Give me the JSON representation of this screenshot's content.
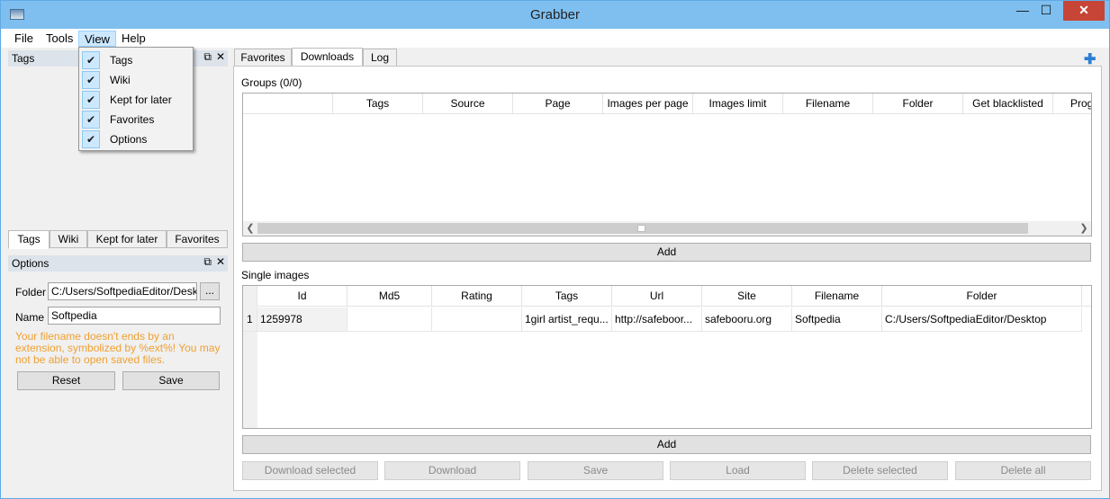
{
  "window": {
    "title": "Grabber"
  },
  "menubar": {
    "file": "File",
    "tools": "Tools",
    "view": "View",
    "help": "Help"
  },
  "view_menu": {
    "items": [
      {
        "label": "Tags",
        "checked": true
      },
      {
        "label": "Wiki",
        "checked": true
      },
      {
        "label": "Kept for later",
        "checked": true
      },
      {
        "label": "Favorites",
        "checked": true
      },
      {
        "label": "Options",
        "checked": true
      }
    ]
  },
  "tags_dock": {
    "title": "Tags"
  },
  "left_tabs": [
    "Tags",
    "Wiki",
    "Kept for later",
    "Favorites"
  ],
  "options_dock": {
    "title": "Options",
    "folder_label": "Folder",
    "folder_value": "C:/Users/SoftpediaEditor/Desktop",
    "browse_label": "...",
    "name_label": "Name",
    "name_value": "Softpedia",
    "warning": "Your filename doesn't ends by an extension, symbolized by %ext%! You may not be able to open saved files.",
    "reset_label": "Reset",
    "save_label": "Save"
  },
  "main_tabs": [
    "Favorites",
    "Downloads",
    "Log"
  ],
  "groups": {
    "label": "Groups (0/0)",
    "columns": [
      "",
      "Tags",
      "Source",
      "Page",
      "Images per page",
      "Images limit",
      "Filename",
      "Folder",
      "Get blacklisted",
      "Prog"
    ],
    "add_label": "Add"
  },
  "single_images": {
    "label": "Single images",
    "columns": [
      "Id",
      "Md5",
      "Rating",
      "Tags",
      "Url",
      "Site",
      "Filename",
      "Folder"
    ],
    "rows": [
      {
        "num": "1",
        "id": "1259978",
        "md5": "",
        "rating": "",
        "tags": "1girl artist_requ...",
        "url": "http://safeboor...",
        "site": "safebooru.org",
        "filename": "Softpedia",
        "folder": "C:/Users/SoftpediaEditor/Desktop"
      }
    ],
    "add_label": "Add"
  },
  "bottom_buttons": [
    "Download selected",
    "Download",
    "Save",
    "Load",
    "Delete selected",
    "Delete all"
  ],
  "colors": {
    "titlebar": "#7fbff0",
    "close": "#c74536",
    "warning": "#f0a030",
    "accent": "#2a7fd3"
  },
  "icons": {
    "add_tab": "plus-icon",
    "float": "float-icon",
    "close": "close-icon"
  }
}
